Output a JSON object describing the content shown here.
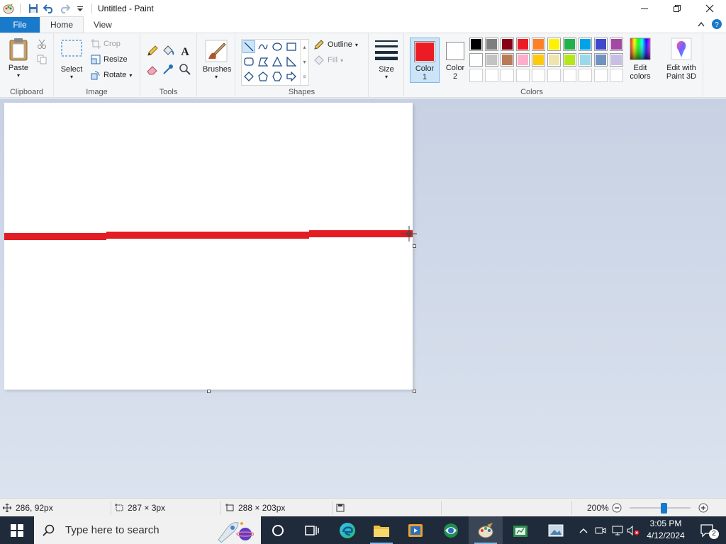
{
  "window": {
    "title": "Untitled - Paint",
    "minimize_icon": "minimize-icon",
    "maximize_icon": "restore-icon",
    "close_icon": "close-icon"
  },
  "tabs": {
    "file": "File",
    "home": "Home",
    "view": "View"
  },
  "ribbon": {
    "clipboard": {
      "label": "Clipboard",
      "paste": "Paste"
    },
    "image": {
      "label": "Image",
      "select": "Select",
      "crop": "Crop",
      "resize": "Resize",
      "rotate": "Rotate"
    },
    "tools": {
      "label": "Tools"
    },
    "brushes": {
      "label": "Brushes"
    },
    "shapes": {
      "label": "Shapes",
      "outline": "Outline",
      "fill": "Fill"
    },
    "size": {
      "label": "Size"
    },
    "colors": {
      "label": "Colors",
      "color1_line1": "Color",
      "color1_line2": "1",
      "color2_line1": "Color",
      "color2_line2": "2",
      "edit_colors_line1": "Edit",
      "edit_colors_line2": "colors",
      "color1_value": "#ed1c24",
      "color2_value": "#ffffff",
      "palette_row1": [
        "#000000",
        "#7f7f7f",
        "#880015",
        "#ed1c24",
        "#ff7f27",
        "#fff200",
        "#22b14c",
        "#00a2e8",
        "#3f48cc",
        "#a349a4"
      ],
      "palette_row2": [
        "#ffffff",
        "#c3c3c3",
        "#b97a57",
        "#ffaec9",
        "#ffc90e",
        "#efe4b0",
        "#b5e61d",
        "#99d9ea",
        "#7092be",
        "#c8bfe7"
      ]
    },
    "paint3d": {
      "line1": "Edit with",
      "line2": "Paint 3D"
    }
  },
  "canvas": {
    "line_color": "#e31b23"
  },
  "status": {
    "cursor_pos": "286, 92px",
    "selection_size": "287 × 3px",
    "image_size": "288 × 203px",
    "zoom": "200%"
  },
  "taskbar": {
    "search_placeholder": "Type here to search",
    "time": "3:05 PM",
    "date": "4/12/2024",
    "notifications_count": "2"
  }
}
